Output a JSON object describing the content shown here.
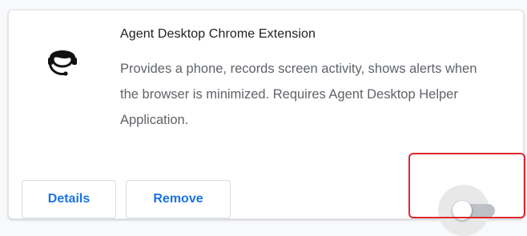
{
  "extension": {
    "name": "Agent Desktop Chrome Extension",
    "description": "Provides a phone, records screen activity, shows alerts when the browser is minimized. Requires Agent Desktop Helper Application.",
    "icon": "headset-agent-icon",
    "enabled": false
  },
  "buttons": {
    "details_label": "Details",
    "remove_label": "Remove"
  },
  "colors": {
    "link_blue": "#1a73e8",
    "highlight_red": "#e0262d",
    "toggle_off_track": "#bdc1c6"
  }
}
